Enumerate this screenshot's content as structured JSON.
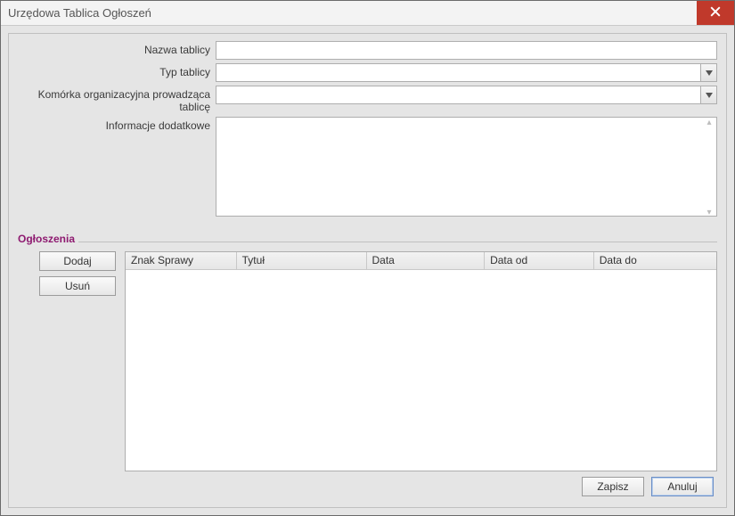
{
  "window": {
    "title": "Urzędowa Tablica Ogłoszeń"
  },
  "form": {
    "nazwa_label": "Nazwa tablicy",
    "nazwa_value": "",
    "typ_label": "Typ tablicy",
    "typ_value": "",
    "komorka_label": "Komórka organizacyjna prowadząca tablicę",
    "komorka_value": "",
    "info_label": "Informacje dodatkowe",
    "info_value": ""
  },
  "announcements": {
    "legend": "Ogłoszenia",
    "add_label": "Dodaj",
    "remove_label": "Usuń",
    "columns": {
      "znak": "Znak Sprawy",
      "tytul": "Tytuł",
      "data": "Data",
      "data_od": "Data od",
      "data_do": "Data do"
    },
    "rows": []
  },
  "footer": {
    "save_label": "Zapisz",
    "cancel_label": "Anuluj"
  }
}
